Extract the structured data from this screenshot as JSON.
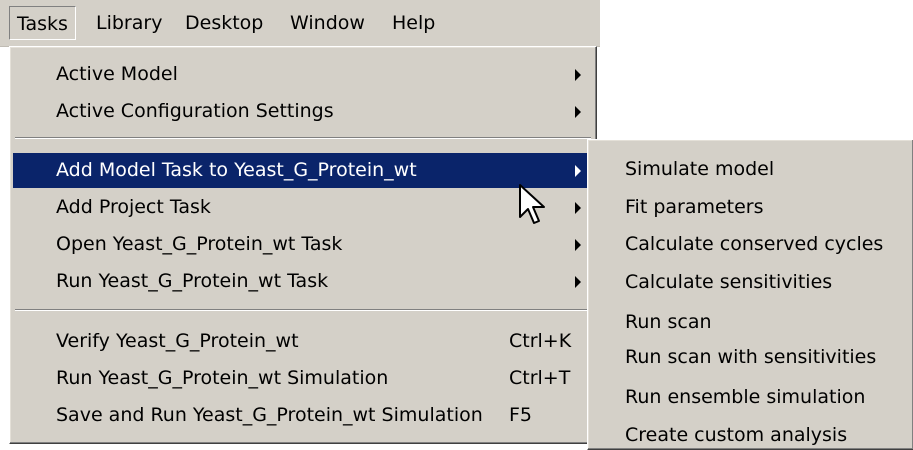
{
  "menubar": {
    "items": [
      {
        "label": "Tasks",
        "active": true
      },
      {
        "label": "Library"
      },
      {
        "label": "Desktop"
      },
      {
        "label": "Window"
      },
      {
        "label": "Help"
      }
    ]
  },
  "tasks_menu": {
    "items": [
      {
        "label": "Active Model",
        "submenu": true
      },
      {
        "label": "Active Configuration Settings",
        "submenu": true
      },
      {
        "label": "Add Model Task to Yeast_G_Protein_wt",
        "submenu": true,
        "highlighted": true
      },
      {
        "label": "Add Project Task",
        "submenu": true
      },
      {
        "label": "Open Yeast_G_Protein_wt Task",
        "submenu": true
      },
      {
        "label": "Run Yeast_G_Protein_wt Task",
        "submenu": true
      },
      {
        "label": "Verify Yeast_G_Protein_wt",
        "shortcut": "Ctrl+K"
      },
      {
        "label": "Run Yeast_G_Protein_wt Simulation",
        "shortcut": "Ctrl+T"
      },
      {
        "label": "Save and Run Yeast_G_Protein_wt Simulation",
        "shortcut": "F5"
      }
    ]
  },
  "add_model_task_submenu": {
    "items": [
      {
        "label": "Simulate model"
      },
      {
        "label": "Fit parameters"
      },
      {
        "label": "Calculate conserved cycles"
      },
      {
        "label": "Calculate sensitivities"
      },
      {
        "label": "Run scan"
      },
      {
        "label": "Run scan with sensitivities"
      },
      {
        "label": "Run ensemble simulation"
      },
      {
        "label": "Create custom analysis"
      }
    ]
  },
  "colors": {
    "menu_bg": "#d4d0c8",
    "highlight_bg": "#0a246a",
    "highlight_text": "#ffffff"
  },
  "icons": [
    "submenu-arrow-icon",
    "mouse-pointer-icon"
  ]
}
